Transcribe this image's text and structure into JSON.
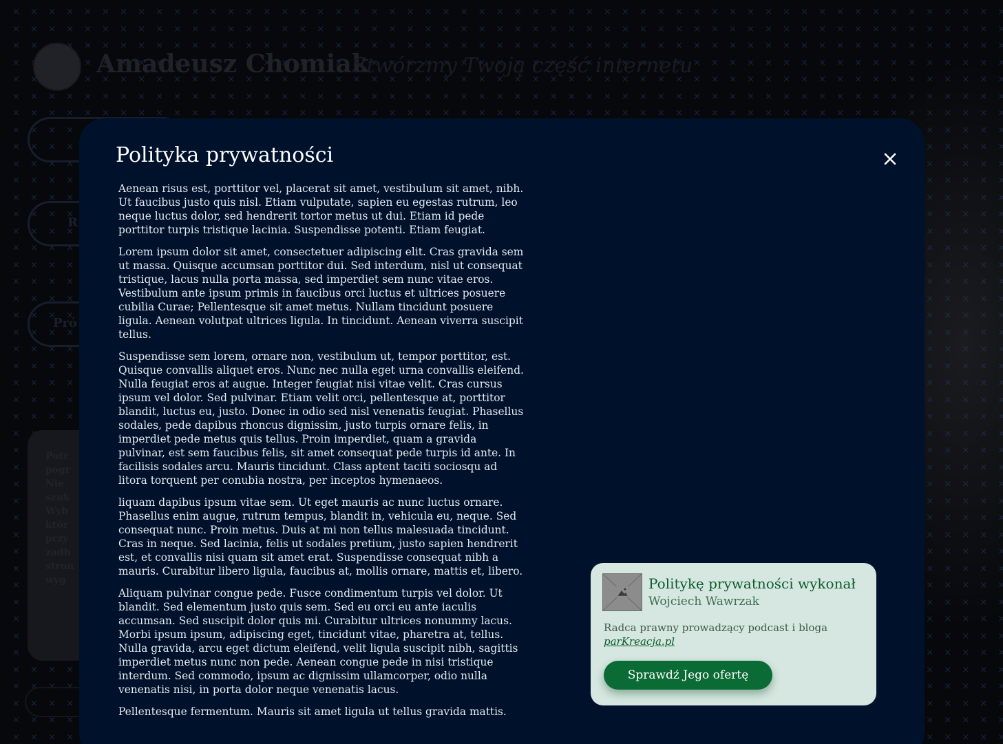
{
  "background": {
    "site_name": "Amadeusz Chomiak",
    "tagline": "Stwórzmy Twoją część internetu",
    "pill_1": "",
    "pill_2": "R",
    "pill_3": "Pró",
    "panel_text": "Potr\npogr\nNie\nszuk\nWyb\nktór\nprzy\nzadb\nstron\nwyg"
  },
  "modal": {
    "title": "Polityka prywatności",
    "close_label": "×",
    "paragraphs": [
      "Aenean risus est, porttitor vel, placerat sit amet, vestibulum sit amet, nibh. Ut faucibus justo quis nisl. Etiam vulputate, sapien eu egestas rutrum, leo neque luctus dolor, sed hendrerit tortor metus ut dui. Etiam id pede porttitor turpis tristique lacinia. Suspendisse potenti. Etiam feugiat.",
      "Lorem ipsum dolor sit amet, consectetuer adipiscing elit. Cras gravida sem ut massa. Quisque accumsan porttitor dui. Sed interdum, nisl ut consequat tristique, lacus nulla porta massa, sed imperdiet sem nunc vitae eros. Vestibulum ante ipsum primis in faucibus orci luctus et ultrices posuere cubilia Curae; Pellentesque sit amet metus. Nullam tincidunt posuere ligula. Aenean volutpat ultrices ligula. In tincidunt. Aenean viverra suscipit tellus.",
      "Suspendisse sem lorem, ornare non, vestibulum ut, tempor porttitor, est. Quisque convallis aliquet eros. Nunc nec nulla eget urna convallis eleifend. Nulla feugiat eros at augue. Integer feugiat nisi vitae velit. Cras cursus ipsum vel dolor. Sed pulvinar. Etiam velit orci, pellentesque at, porttitor blandit, luctus eu, justo. Donec in odio sed nisl venenatis feugiat. Phasellus sodales, pede dapibus rhoncus dignissim, justo turpis ornare felis, in imperdiet pede metus quis tellus. Proin imperdiet, quam a gravida pulvinar, est sem faucibus felis, sit amet consequat pede turpis id ante. In facilisis sodales arcu. Mauris tincidunt. Class aptent taciti sociosqu ad litora torquent per conubia nostra, per inceptos hymenaeos.",
      "liquam dapibus ipsum vitae sem. Ut eget mauris ac nunc luctus ornare. Phasellus enim augue, rutrum tempus, blandit in, vehicula eu, neque. Sed consequat nunc. Proin metus. Duis at mi non tellus malesuada tincidunt. Cras in neque. Sed lacinia, felis ut sodales pretium, justo sapien hendrerit est, et convallis nisi quam sit amet erat. Suspendisse consequat nibh a mauris. Curabitur libero ligula, faucibus at, mollis ornare, mattis et, libero.",
      "Aliquam pulvinar congue pede. Fusce condimentum turpis vel dolor. Ut blandit. Sed elementum justo quis sem. Sed eu orci eu ante iaculis accumsan. Sed suscipit dolor quis mi. Curabitur ultrices nonummy lacus. Morbi ipsum ipsum, adipiscing eget, tincidunt vitae, pharetra at, tellus. Nulla gravida, arcu eget dictum eleifend, velit ligula suscipit nibh, sagittis imperdiet metus nunc non pede. Aenean congue pede in nisi tristique interdum. Sed commodo, ipsum ac dignissim ullamcorper, odio nulla venenatis nisi, in porta dolor neque venenatis lacus.",
      "Pellentesque fermentum. Mauris sit amet ligula ut tellus gravida mattis."
    ]
  },
  "credit": {
    "title": "Politykę prywatności wykonał",
    "name": "Wojciech Wawrzak",
    "description_prefix": "Radca prawny prowadzący podcast i bloga",
    "link_text": "parKreacja.pl",
    "button_label": "Sprawdź Jego ofertę",
    "image_icon": "image-placeholder-icon"
  },
  "colors": {
    "modal_bg": "#00112b",
    "card_bg": "#d5e7e0",
    "accent_green": "#0a6b35",
    "pattern_blue": "#466ebe"
  }
}
